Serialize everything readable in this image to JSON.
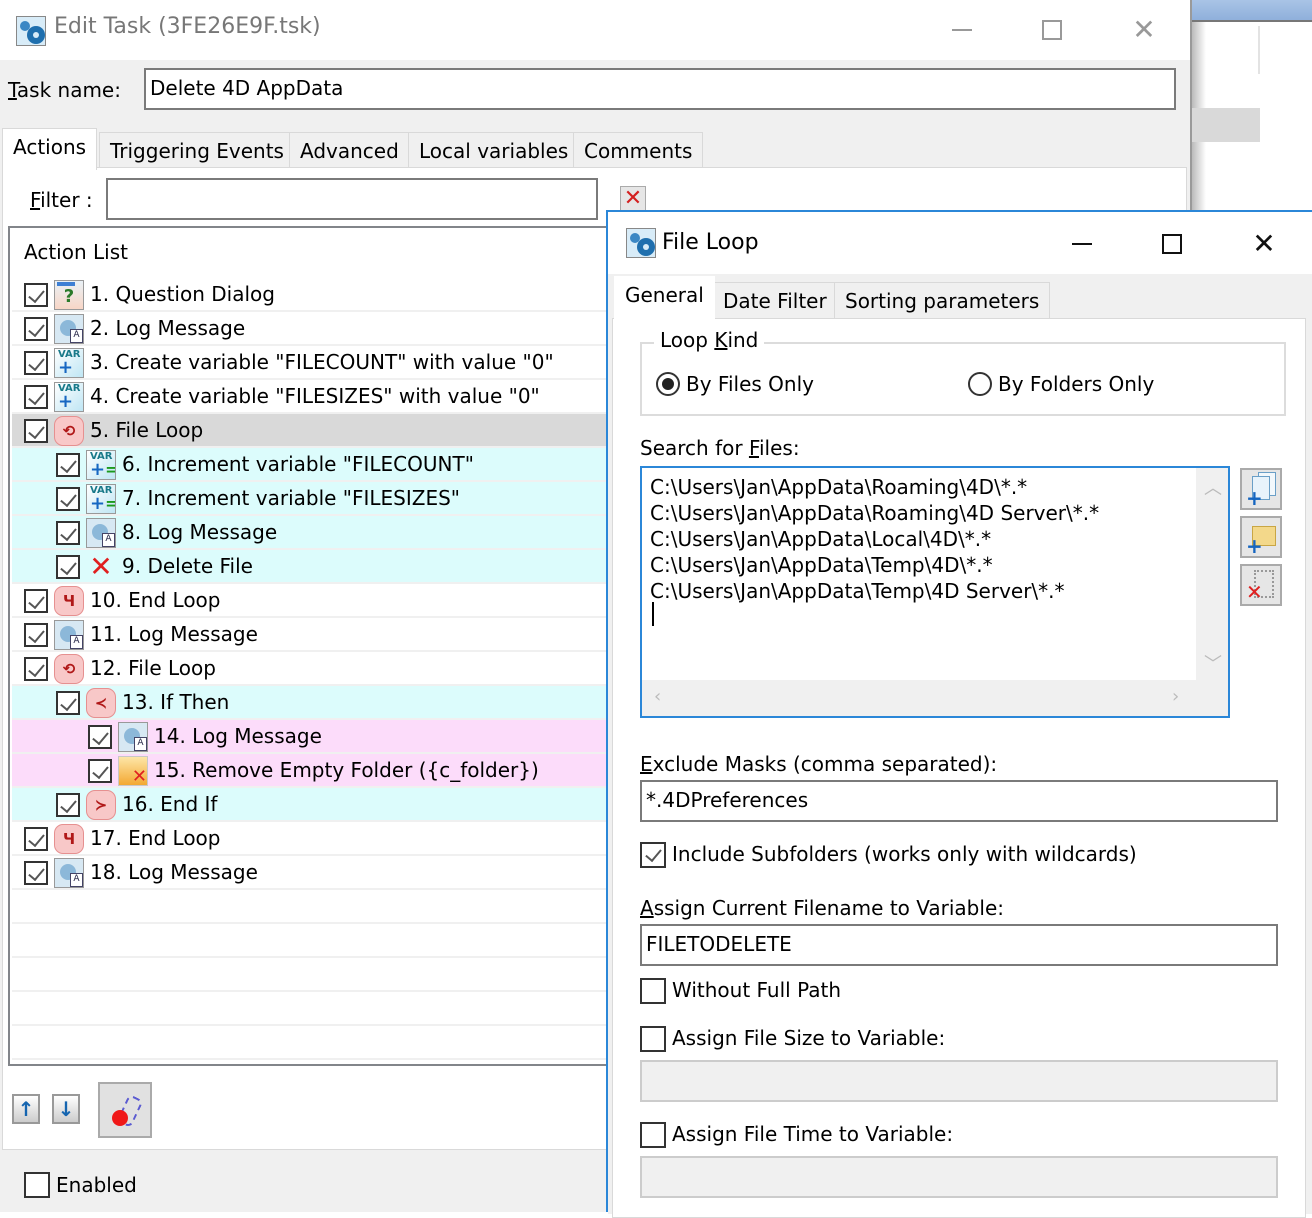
{
  "main_window": {
    "title": "Edit Task (3FE26E9F.tsk)",
    "controls": {
      "minimize": "minimize",
      "maximize": "maximize",
      "close": "close"
    },
    "task_name_label_u": "T",
    "task_name_label_rest": "ask name:",
    "task_name_value": "Delete 4D AppData",
    "tabs": [
      {
        "label": "Actions",
        "active": true
      },
      {
        "label": "Triggering Events",
        "active": false
      },
      {
        "label": "Advanced",
        "active": false
      },
      {
        "label": "Local variables",
        "active": false
      },
      {
        "label": "Comments",
        "active": false
      }
    ],
    "filter_label_u": "F",
    "filter_label_rest": "ilter :",
    "filter_value": "",
    "filter_clear_icon": "✕",
    "action_list": {
      "header": "Action List",
      "items": [
        {
          "label": "1. Question Dialog",
          "level": 0,
          "checked": true,
          "icon": "question-dialog",
          "highlight": "none"
        },
        {
          "label": "2. Log Message",
          "level": 0,
          "checked": true,
          "icon": "log-message",
          "highlight": "none"
        },
        {
          "label": "3. Create variable \"FILECOUNT\" with value \"0\"",
          "level": 0,
          "checked": true,
          "icon": "create-variable",
          "highlight": "none"
        },
        {
          "label": "4. Create variable \"FILESIZES\" with value \"0\"",
          "level": 0,
          "checked": true,
          "icon": "create-variable",
          "highlight": "none"
        },
        {
          "label": "5. File Loop",
          "level": 0,
          "checked": true,
          "icon": "file-loop",
          "highlight": "selected"
        },
        {
          "label": "6. Increment variable \"FILECOUNT\"",
          "level": 1,
          "checked": true,
          "icon": "increment-variable",
          "highlight": "cyan"
        },
        {
          "label": "7. Increment variable \"FILESIZES\"",
          "level": 1,
          "checked": true,
          "icon": "increment-variable",
          "highlight": "cyan"
        },
        {
          "label": "8. Log Message",
          "level": 1,
          "checked": true,
          "icon": "log-message",
          "highlight": "cyan"
        },
        {
          "label": "9. Delete File",
          "level": 1,
          "checked": true,
          "icon": "delete-file",
          "highlight": "cyan"
        },
        {
          "label": "10. End Loop",
          "level": 0,
          "checked": true,
          "icon": "end-loop",
          "highlight": "none"
        },
        {
          "label": "11. Log Message",
          "level": 0,
          "checked": true,
          "icon": "log-message",
          "highlight": "none"
        },
        {
          "label": "12. File Loop",
          "level": 0,
          "checked": true,
          "icon": "file-loop",
          "highlight": "none"
        },
        {
          "label": "13. If Then",
          "level": 1,
          "checked": true,
          "icon": "if-then",
          "highlight": "cyan"
        },
        {
          "label": "14. Log Message",
          "level": 2,
          "checked": true,
          "icon": "log-message",
          "highlight": "pink"
        },
        {
          "label": "15. Remove Empty Folder ({c_folder})",
          "level": 2,
          "checked": true,
          "icon": "remove-folder",
          "highlight": "pink"
        },
        {
          "label": "16. End If",
          "level": 1,
          "checked": true,
          "icon": "end-if",
          "highlight": "cyan"
        },
        {
          "label": "17. End Loop",
          "level": 0,
          "checked": true,
          "icon": "end-loop",
          "highlight": "none"
        },
        {
          "label": "18. Log Message",
          "level": 0,
          "checked": true,
          "icon": "log-message",
          "highlight": "none"
        }
      ]
    },
    "move_up_icon": "↑",
    "move_down_icon": "↓",
    "record_button": "record-macro",
    "enabled_label": "Enabled",
    "enabled_checked": false
  },
  "file_loop_dialog": {
    "title": "File Loop",
    "close_glyph": "✕",
    "tabs": [
      {
        "label": "General",
        "active": true
      },
      {
        "label": "Date Filter",
        "active": false
      },
      {
        "label": "Sorting parameters",
        "active": false
      }
    ],
    "loop_kind": {
      "legend_pre": "Loop ",
      "legend_u": "K",
      "legend_post": "ind",
      "options": [
        {
          "label": "By Files Only",
          "selected": true
        },
        {
          "label": "By Folders Only",
          "selected": false
        }
      ]
    },
    "search_files_label_pre": "Search for ",
    "search_files_label_u": "F",
    "search_files_label_post": "iles:",
    "search_files": [
      "C:\\Users\\Jan\\AppData\\Roaming\\4D\\*.*",
      "C:\\Users\\Jan\\AppData\\Roaming\\4D Server\\*.*",
      "C:\\Users\\Jan\\AppData\\Local\\4D\\*.*",
      "C:\\Users\\Jan\\AppData\\Temp\\4D\\*.*",
      "C:\\Users\\Jan\\AppData\\Temp\\4D Server\\*.*"
    ],
    "side_buttons": [
      "add-file",
      "add-folder",
      "remove-entry"
    ],
    "exclude_label_u": "E",
    "exclude_label_rest": "xclude Masks (comma separated):",
    "exclude_value": "*.4DPreferences",
    "include_subfolders_label": "Include Subfolders (works only with wildcards)",
    "include_subfolders_checked": true,
    "assign_filename_label_u": "A",
    "assign_filename_label_rest": "ssign Current Filename to Variable:",
    "assign_filename_value": "FILETODELETE",
    "without_full_path_label": "Without Full Path",
    "without_full_path_checked": false,
    "assign_size_label": "Assign File Size to Variable:",
    "assign_size_checked": false,
    "assign_size_value": "",
    "assign_time_label": "Assign File Time to Variable:",
    "assign_time_checked": false,
    "assign_time_value": ""
  }
}
